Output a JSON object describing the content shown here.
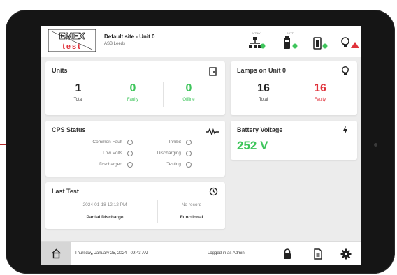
{
  "colors": {
    "green": "#3ec55b",
    "red": "#e0323b",
    "dark": "#222222"
  },
  "header": {
    "logo_top": "EMEX",
    "logo_bottom": "test",
    "site_name": "Default site - Unit 0",
    "site_sub": "ASB Leeds",
    "icons": [
      {
        "name": "network-icon",
        "caption": "NTWK"
      },
      {
        "name": "battery-status-icon",
        "caption": "BATT"
      },
      {
        "name": "charger-icon",
        "caption": ""
      },
      {
        "name": "lamp-alert-icon",
        "caption": ""
      }
    ]
  },
  "units": {
    "title": "Units",
    "icon": "door-icon",
    "total": {
      "value": "1",
      "label": "Total"
    },
    "faulty": {
      "value": "0",
      "label": "Faulty"
    },
    "offline": {
      "value": "0",
      "label": "Offline"
    }
  },
  "lamps": {
    "title": "Lamps on Unit 0",
    "icon": "bulb-icon",
    "total": {
      "value": "16",
      "label": "Total"
    },
    "faulty": {
      "value": "16",
      "label": "Faulty"
    }
  },
  "cps": {
    "title": "CPS Status",
    "icon": "waveform-icon",
    "left": [
      "Common Fault",
      "Low Volts",
      "Discharged"
    ],
    "right": [
      "Inhibit",
      "Discharging",
      "Testing"
    ]
  },
  "battery": {
    "title": "Battery Voltage",
    "icon": "bolt-icon",
    "value": "252 V"
  },
  "last_test": {
    "title": "Last Test",
    "icon": "history-icon",
    "left_date": "2024-01-18 12:12 PM",
    "left_type": "Partial Discharge",
    "right_date": "No record",
    "right_type": "Functional"
  },
  "footer": {
    "datetime": "Thursday, January 25, 2024 - 09:43 AM",
    "logged_in": "Logged in as Admin",
    "icons": [
      "home-icon",
      "lock-icon",
      "report-icon",
      "settings-icon"
    ]
  }
}
